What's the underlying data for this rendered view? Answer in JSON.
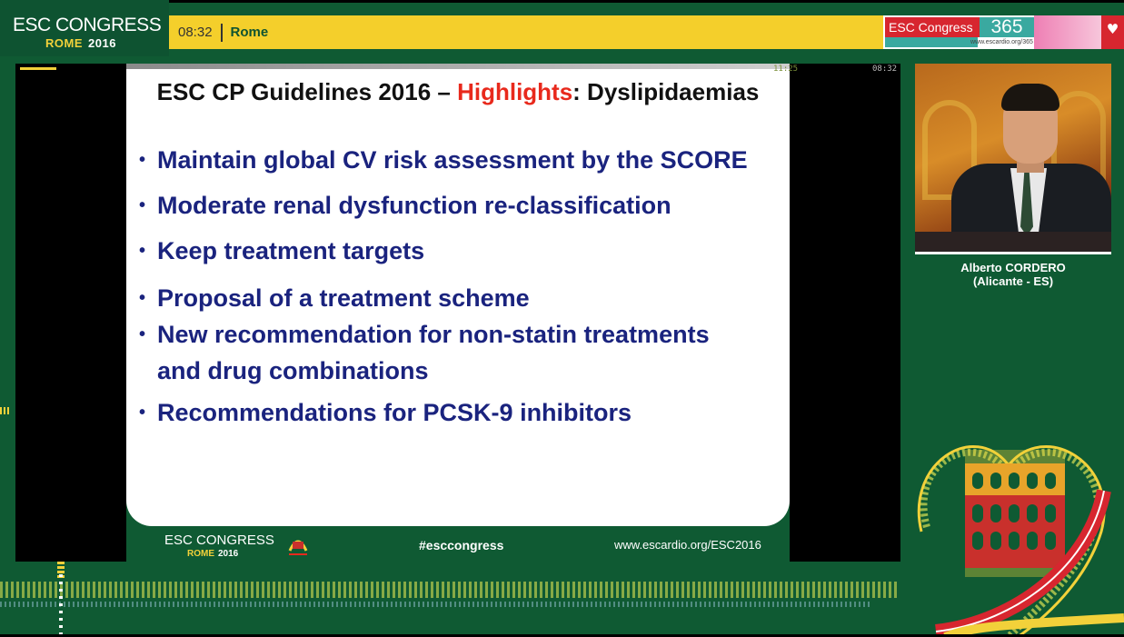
{
  "header": {
    "logo_title": "ESC CONGRESS",
    "logo_city": "ROME",
    "logo_year": "2016",
    "time": "08:32",
    "city": "Rome",
    "brand_label": "ESC Congress",
    "brand_number": "365",
    "brand_url": "www.escardio.org/365"
  },
  "player": {
    "elapsed": "08:32",
    "overlay_time": "11:25"
  },
  "slide": {
    "title_prefix": "ESC CP Guidelines 2016 – ",
    "title_highlight": "Highlights",
    "title_suffix": ": Dyslipidaemias",
    "bullets": [
      "Maintain global CV risk assessment by the SCORE",
      "Moderate renal dysfunction re-classification",
      "Keep treatment targets",
      "Proposal of a treatment scheme",
      "New recommendation for non-statin treatments",
      "and drug combinations",
      "Recommendations for PCSK-9 inhibitors"
    ],
    "footer_logo": "ESC CONGRESS",
    "footer_city": "ROME",
    "footer_year": "2016",
    "hashtag": "#esccongress",
    "url": "www.escardio.org/ESC2016"
  },
  "speaker": {
    "name": "Alberto CORDERO",
    "affiliation": "(Alicante - ES)"
  },
  "colors": {
    "background": "#0f5a33",
    "accent_yellow": "#f4cf2b",
    "highlight_red": "#e8291c",
    "bullet_blue": "#1a237e"
  }
}
